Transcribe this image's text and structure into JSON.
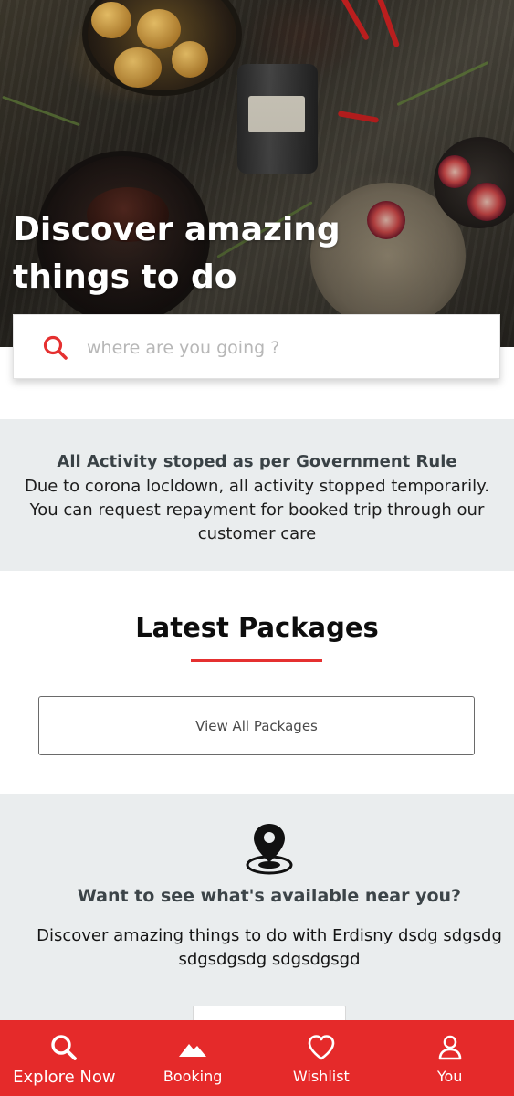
{
  "hero": {
    "title": "Discover amazing\nthings to do"
  },
  "search": {
    "icon": "search-icon",
    "placeholder": "where are you going ?"
  },
  "notice": {
    "title": "All Activity stoped as per Government Rule",
    "body": "Due to corona locldown, all activity stopped temporarily. You can request repayment for booked trip through our customer care"
  },
  "latest_packages": {
    "title": "Latest Packages",
    "view_all_label": "View All Packages"
  },
  "near_you": {
    "icon": "location-pin-icon",
    "title": "Want to see what's available near you?",
    "body": "Discover amazing things to do with Erdisny dsdg sdgsdg sdgsdgsdg sdgsdgsgd"
  },
  "bottom_nav": {
    "items": [
      {
        "label": "Explore Now",
        "icon": "search-icon",
        "active": true
      },
      {
        "label": "Booking",
        "icon": "mountain-icon",
        "active": false
      },
      {
        "label": "Wishlist",
        "icon": "heart-icon",
        "active": false
      },
      {
        "label": "You",
        "icon": "user-icon",
        "active": false
      }
    ]
  },
  "colors": {
    "accent": "#e52a2a",
    "section_bg": "#eaedee",
    "search_icon": "#e53030"
  }
}
